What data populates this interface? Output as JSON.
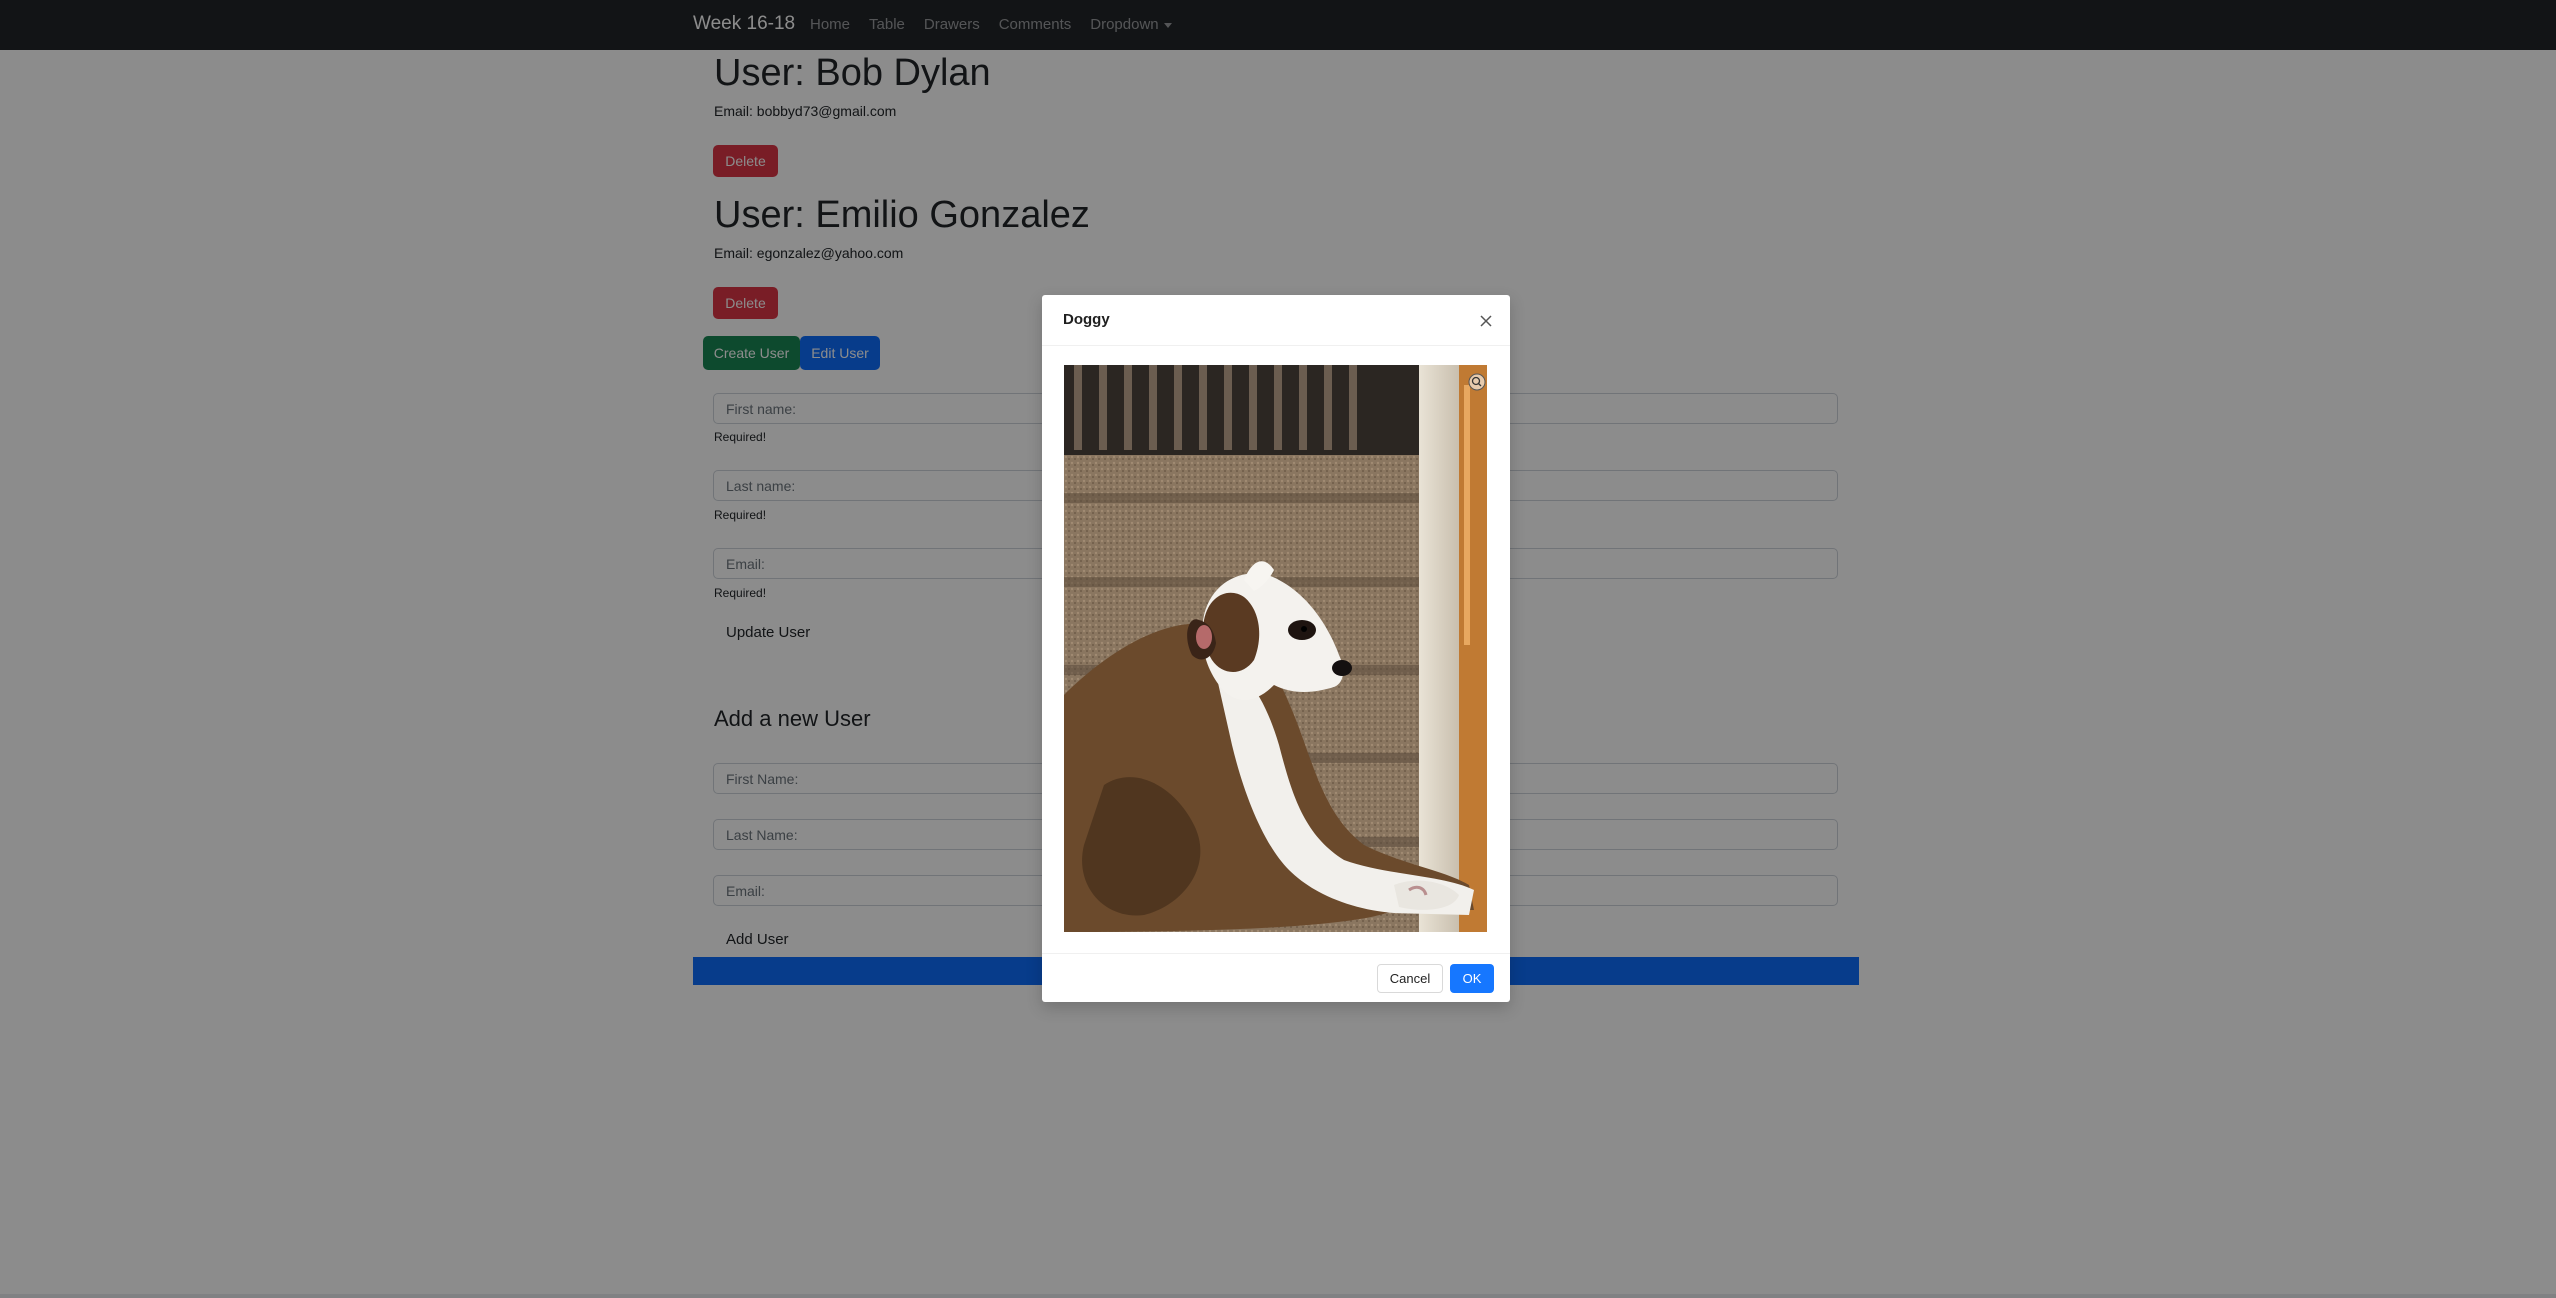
{
  "navbar": {
    "brand": "Week 16-18",
    "links": [
      "Home",
      "Table",
      "Drawers",
      "Comments",
      "Dropdown"
    ]
  },
  "users": [
    {
      "heading": "User: Bob Dylan",
      "email": "Email: bobbyd73@gmail.com",
      "delete_label": "Delete"
    },
    {
      "heading": "User: Emilio Gonzalez",
      "email": "Email: egonzalez@yahoo.com",
      "delete_label": "Delete"
    }
  ],
  "actions": {
    "create_label": "Create User",
    "edit_label": "Edit User"
  },
  "edit_form": {
    "first_name_placeholder": "First name:",
    "last_name_placeholder": "Last name:",
    "email_placeholder": "Email:",
    "required_text": "Required!",
    "update_label": "Update User"
  },
  "add_form": {
    "heading": "Add a new User",
    "first_name_placeholder": "First Name:",
    "last_name_placeholder": "Last Name:",
    "email_placeholder": "Email:",
    "add_label": "Add User"
  },
  "modal": {
    "title": "Doggy",
    "cancel_label": "Cancel",
    "ok_label": "OK",
    "close_icon": "close-icon",
    "image_subject": "dog-on-stairs-photo"
  },
  "colors": {
    "navbar": "#212529",
    "danger": "#dc3545",
    "success": "#198754",
    "primary": "#0d6efd",
    "modal_ok": "#1677ff"
  }
}
